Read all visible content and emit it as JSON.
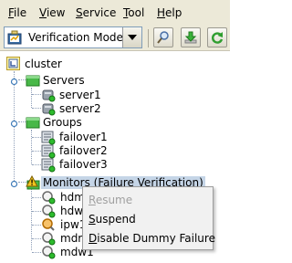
{
  "menubar": {
    "items": [
      {
        "label": "File",
        "mnemonic": "F",
        "rest": "ile"
      },
      {
        "label": "View",
        "mnemonic": "V",
        "rest": "iew"
      },
      {
        "label": "Service",
        "mnemonic": "S",
        "rest": "ervice"
      },
      {
        "label": "Tool",
        "mnemonic": "T",
        "rest": "ool"
      },
      {
        "label": "Help",
        "mnemonic": "H",
        "rest": "elp"
      }
    ]
  },
  "toolbar": {
    "mode_select": {
      "value": "Verification Mode",
      "icon": "verification-mode-icon"
    },
    "buttons": [
      {
        "name": "search-button",
        "icon": "magnifier-icon"
      },
      {
        "name": "download-button",
        "icon": "green-down-arrow-icon"
      },
      {
        "name": "refresh-button",
        "icon": "green-refresh-icon"
      }
    ]
  },
  "tree": {
    "root": {
      "label": "cluster"
    },
    "groups": [
      {
        "label": "Servers",
        "children": [
          "server1",
          "server2"
        ]
      },
      {
        "label": "Groups",
        "children": [
          "failover1",
          "failover2",
          "failover3"
        ]
      },
      {
        "label": "Monitors (Failure Verification)",
        "children": [
          "hdm",
          "hdw",
          "ipw1",
          "mdr",
          "mdw1"
        ]
      }
    ]
  },
  "context_menu": {
    "items": [
      {
        "label": "Resume",
        "mnemonic": "R",
        "rest": "esume",
        "enabled": false
      },
      {
        "label": "Suspend",
        "mnemonic": "S",
        "rest": "uspend",
        "enabled": true
      },
      {
        "label": "Disable Dummy Failure",
        "mnemonic": "D",
        "rest": "isable Dummy Failure",
        "enabled": true
      }
    ]
  },
  "colors": {
    "chrome": "#ece9d8",
    "selection": "#c5d5e7",
    "folder_green": "#3fae3f",
    "status_green": "#2dbb2d",
    "warning_yellow": "#f2c61f"
  }
}
